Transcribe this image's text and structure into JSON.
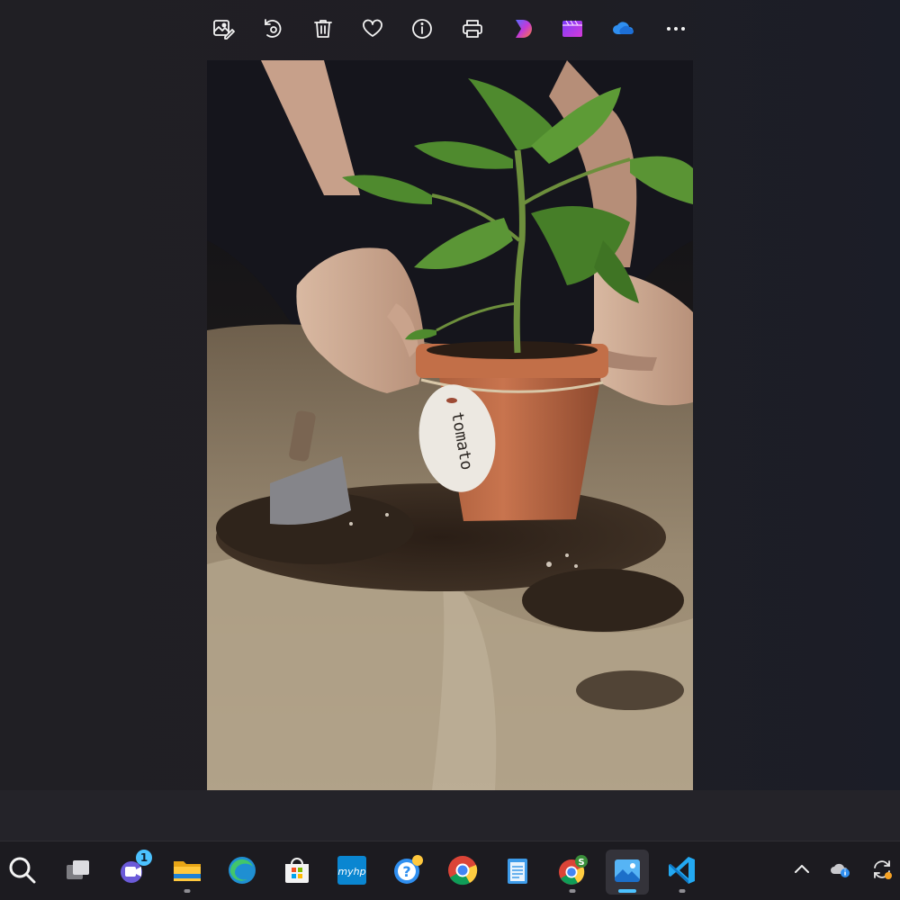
{
  "window": {
    "title": "Photos",
    "image_tag_text": "tomato"
  },
  "toolbar": {
    "buttons": [
      {
        "name": "edit-image",
        "icon": "edit-image-icon"
      },
      {
        "name": "rotate",
        "icon": "rotate-icon"
      },
      {
        "name": "delete",
        "icon": "trash-icon"
      },
      {
        "name": "favorite",
        "icon": "heart-icon"
      },
      {
        "name": "file-info",
        "icon": "info-icon"
      },
      {
        "name": "print",
        "icon": "printer-icon"
      },
      {
        "name": "designer",
        "icon": "designer-icon"
      },
      {
        "name": "clipchamp",
        "icon": "clipchamp-icon"
      },
      {
        "name": "onedrive",
        "icon": "onedrive-cloud-icon"
      },
      {
        "name": "more",
        "icon": "more-options-icon"
      }
    ]
  },
  "taskbar": {
    "apps": [
      {
        "name": "search",
        "icon": "search-icon",
        "running": false
      },
      {
        "name": "task-view",
        "icon": "task-view-icon",
        "running": false
      },
      {
        "name": "teams",
        "icon": "teams-icon",
        "running": false,
        "badge": "1"
      },
      {
        "name": "file-explorer",
        "icon": "folder-icon",
        "running": true
      },
      {
        "name": "edge",
        "icon": "edge-icon",
        "running": false
      },
      {
        "name": "microsoft-store",
        "icon": "store-icon",
        "running": false
      },
      {
        "name": "myhp",
        "icon": "myhp-icon",
        "running": false,
        "label": "myhp"
      },
      {
        "name": "get-help",
        "icon": "help-icon",
        "running": false
      },
      {
        "name": "chrome",
        "icon": "chrome-icon",
        "running": false
      },
      {
        "name": "notepad",
        "icon": "notepad-icon",
        "running": false
      },
      {
        "name": "chrome-profile",
        "icon": "chrome-profile-icon",
        "running": true,
        "profile_letter": "S"
      },
      {
        "name": "photos",
        "icon": "photos-icon",
        "running": true,
        "active": true
      },
      {
        "name": "vscode",
        "icon": "vscode-icon",
        "running": true
      }
    ],
    "tray": [
      {
        "name": "show-hidden-icons",
        "icon": "chevron-up-icon"
      },
      {
        "name": "onedrive-status",
        "icon": "cloud-info-icon"
      },
      {
        "name": "sync-update",
        "icon": "sync-icon"
      }
    ]
  },
  "colors": {
    "background": "#1f1e23",
    "taskbar": "#1c1b20",
    "accent": "#4cc2ff"
  }
}
